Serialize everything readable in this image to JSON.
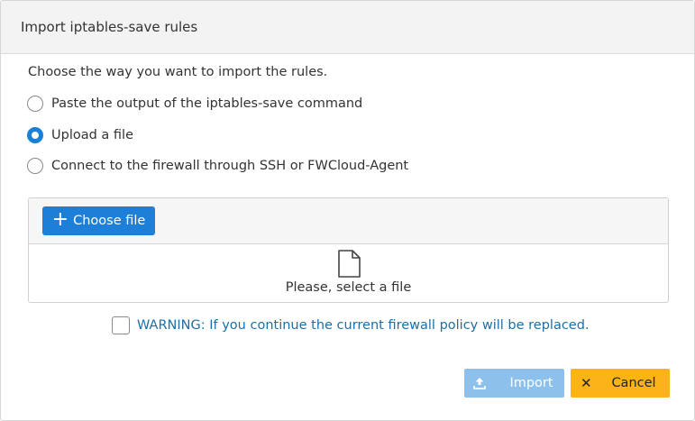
{
  "dialog": {
    "title": "Import iptables-save rules",
    "intro": "Choose the way you want to import the rules.",
    "options": [
      {
        "label": "Paste the output of the iptables-save command",
        "checked": false
      },
      {
        "label": "Upload a file",
        "checked": true
      },
      {
        "label": "Connect to the firewall through SSH or FWCloud-Agent",
        "checked": false
      }
    ],
    "uploader": {
      "choose_label": "Choose file",
      "choose_icon": "plus-icon",
      "empty_icon": "file-icon",
      "empty_text": "Please, select a file"
    },
    "warning": {
      "checked": false,
      "text": "WARNING: If you continue the current firewall policy will be replaced."
    },
    "buttons": {
      "import_label": "Import",
      "import_icon": "upload-icon",
      "cancel_label": "Cancel",
      "cancel_icon": "close-icon"
    }
  },
  "colors": {
    "primary": "#1e7fd8",
    "import_disabled": "#8ec0ec",
    "cancel": "#fbb319",
    "warning_text": "#1d6fa5"
  }
}
